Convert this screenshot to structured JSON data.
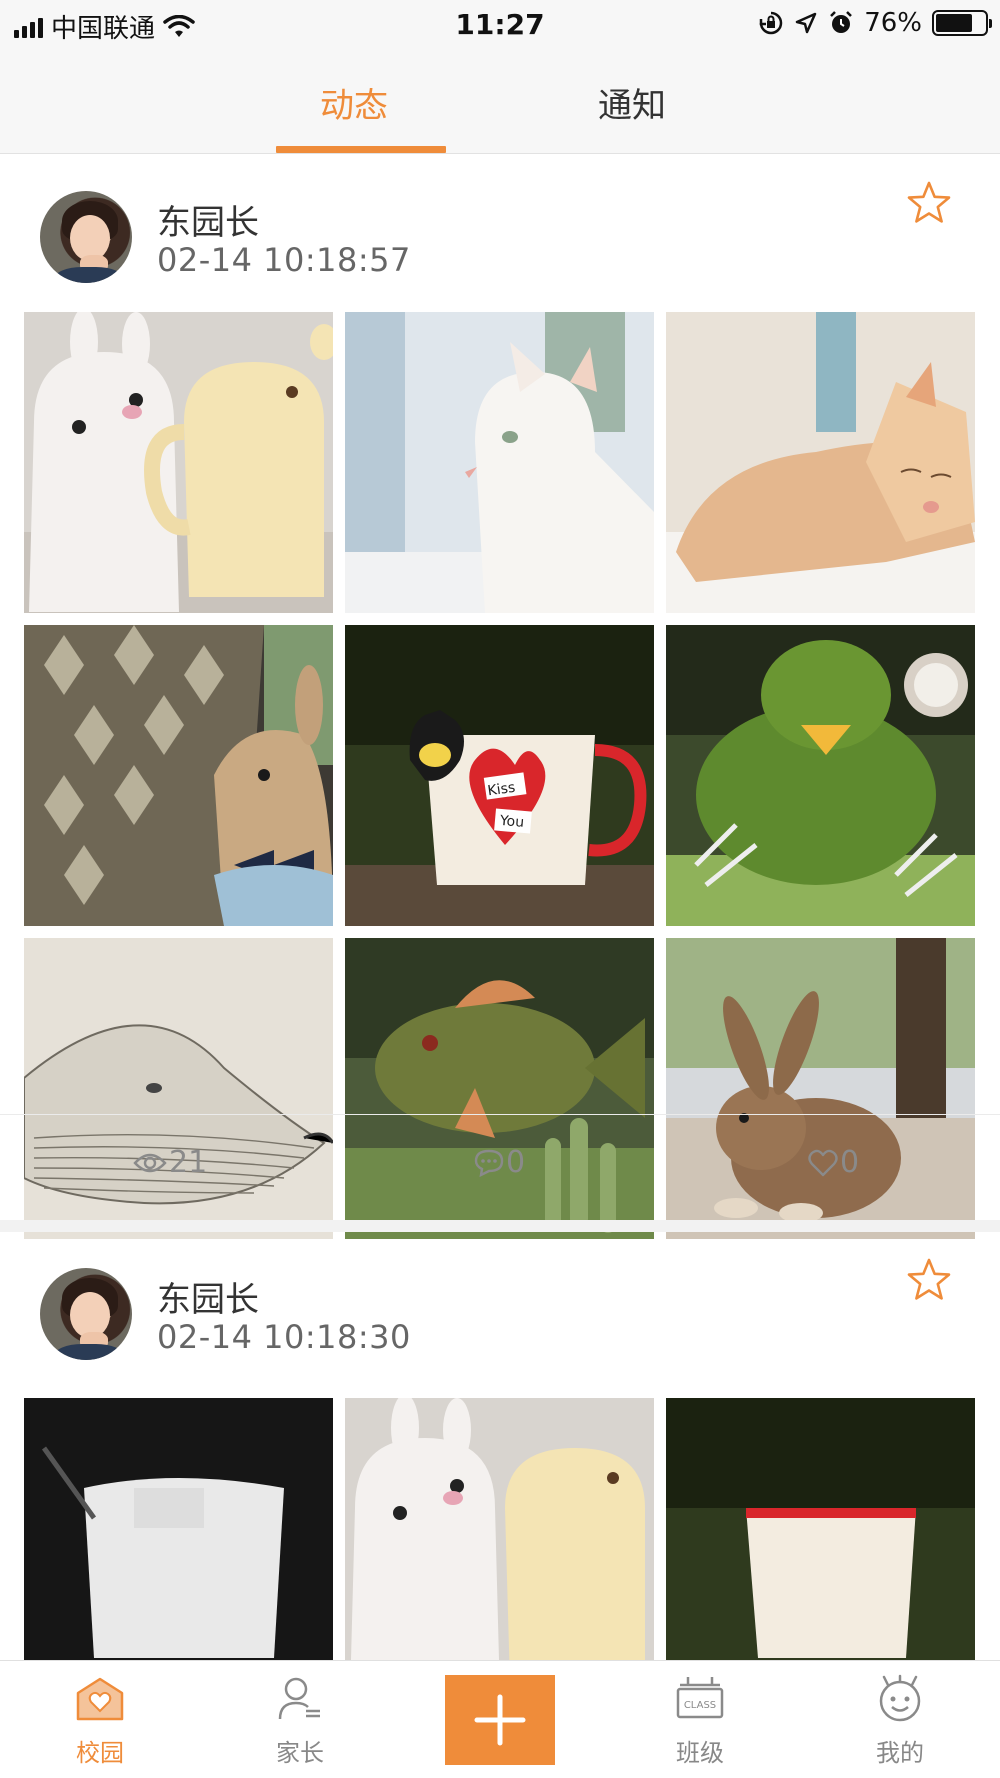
{
  "status_bar": {
    "carrier": "中国联通",
    "time": "11:27",
    "battery": "76%",
    "battery_level": 0.76
  },
  "tabs": [
    {
      "label": "动态",
      "active": true
    },
    {
      "label": "通知",
      "active": false
    }
  ],
  "accent_color": "#ef8c3a",
  "posts": [
    {
      "author": "东园长",
      "time": "02-14 10:18:57",
      "photos": [
        "bunny-and-bear-mugs",
        "white-kitten",
        "sleeping-orange-cat",
        "rabbit-with-bowtie",
        "cat-kiss-you-mug",
        "green-topiary-bird",
        "whale-sketch",
        "topiary-fish",
        "brown-rabbit"
      ],
      "stats": {
        "views": "21",
        "comments": "0",
        "likes": "0"
      }
    },
    {
      "author": "东园长",
      "time": "02-14 10:18:30",
      "photos": [
        "black-cup",
        "bunny-and-bear-mugs",
        "green-background-mug"
      ]
    }
  ],
  "mug_text": {
    "kiss": "Kiss",
    "you": "You",
    "class": "CLASS"
  },
  "bottom_nav": [
    {
      "label": "校园",
      "icon": "school-house-icon",
      "active": true
    },
    {
      "label": "家长",
      "icon": "parent-user-icon",
      "active": false
    },
    {
      "label": "",
      "icon": "plus-icon",
      "active": false
    },
    {
      "label": "班级",
      "icon": "class-board-icon",
      "active": false
    },
    {
      "label": "我的",
      "icon": "smiley-face-icon",
      "active": false
    }
  ]
}
